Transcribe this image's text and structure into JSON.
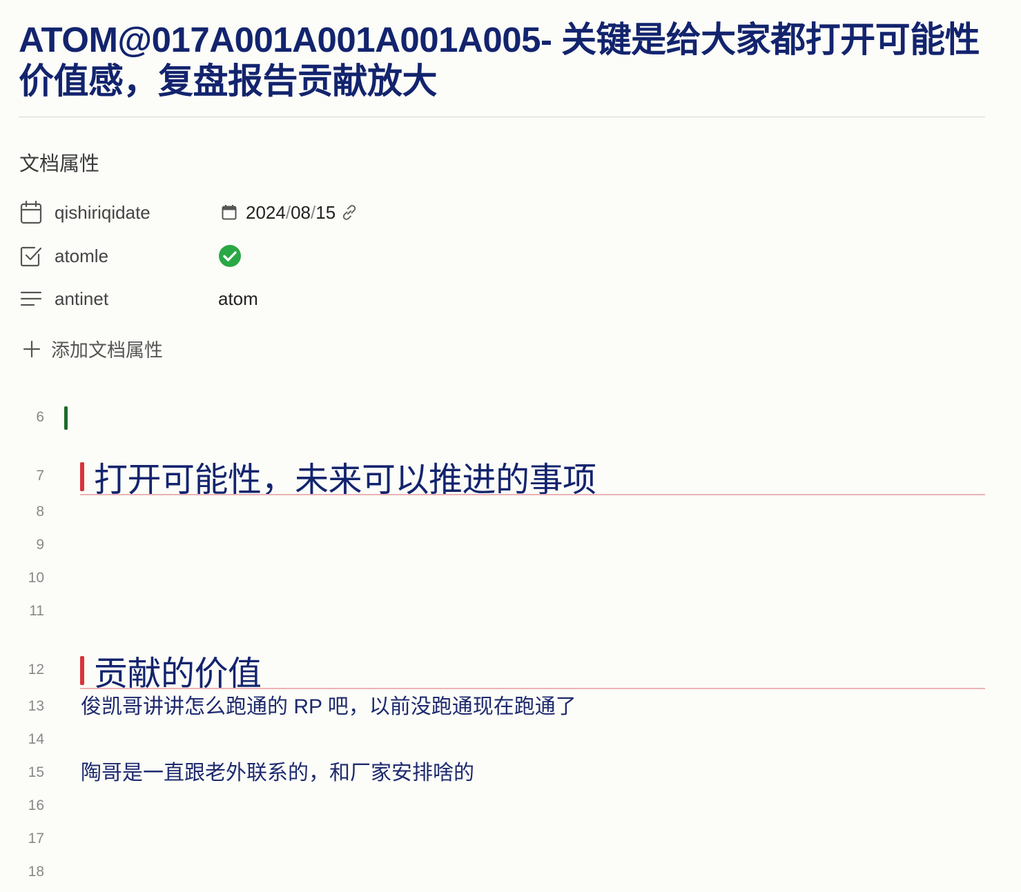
{
  "document": {
    "title": "ATOM@017A001A001A001A005- 关键是给大家都打开可能性价值感，复盘报告贡献放大"
  },
  "properties": {
    "heading": "文档属性",
    "items": [
      {
        "name": "qishiriqidate",
        "icon": "calendar-icon",
        "value_year": "2024",
        "value_month": "08",
        "value_day": "15",
        "value_icon": "link-icon"
      },
      {
        "name": "atomle",
        "icon": "checkbox-icon",
        "value_checked": true,
        "value_icon": "check-circle-icon"
      },
      {
        "name": "antinet",
        "icon": "text-lines-icon",
        "value": "atom"
      }
    ],
    "add_label": "添加文档属性"
  },
  "editor": {
    "lines": [
      {
        "num": "6",
        "text": ""
      },
      {
        "num": "7",
        "text": "打开可能性，未来可以推进的事项",
        "type": "heading"
      },
      {
        "num": "8",
        "text": ""
      },
      {
        "num": "9",
        "text": ""
      },
      {
        "num": "10",
        "text": ""
      },
      {
        "num": "11",
        "text": ""
      },
      {
        "num": "12",
        "text": "贡献的价值",
        "type": "heading"
      },
      {
        "num": "13",
        "text": "俊凯哥讲讲怎么跑通的 RP 吧，以前没跑通现在跑通了"
      },
      {
        "num": "14",
        "text": ""
      },
      {
        "num": "15",
        "text": "陶哥是一直跟老外联系的，和厂家安排啥的"
      },
      {
        "num": "16",
        "text": ""
      },
      {
        "num": "17",
        "text": ""
      },
      {
        "num": "18",
        "text": ""
      }
    ]
  },
  "colors": {
    "title": "#13246e",
    "heading_marker": "#d6353a",
    "cursor": "#1e6b2a",
    "check": "#2aa845"
  }
}
